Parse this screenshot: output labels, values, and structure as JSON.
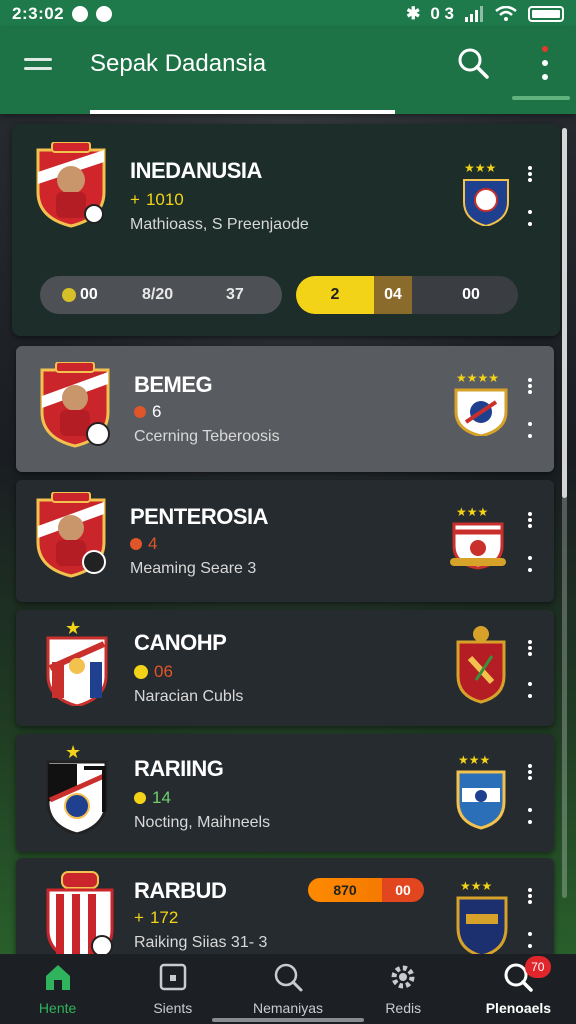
{
  "status_bar": {
    "time": "2:3:02",
    "signal_text": "0 3"
  },
  "app_bar": {
    "title": "Sepak Dadansia"
  },
  "featured": {
    "name": "INEDANUSIA",
    "stat": "1010",
    "stat_prefix": "+",
    "sub": "Mathioass, S Preenjaode",
    "score_left": [
      "00",
      "8/20",
      "37"
    ],
    "score_right": [
      "2",
      "04",
      "00"
    ]
  },
  "teams": [
    {
      "name": "BEMEG",
      "stat": "6",
      "ball_color": "#e0552a",
      "sub": "Ccerning Teberoosis"
    },
    {
      "name": "PENTEROSIA",
      "stat": "4",
      "ball_color": "#e0552a",
      "sub": "Meaming Seare 3"
    },
    {
      "name": "CANOHP",
      "stat": "06",
      "ball_color": "#f3d317",
      "sub": "Naracian Cubls"
    },
    {
      "name": "RARIING",
      "stat": "14",
      "ball_color": "#f3d317",
      "sub": "Nocting, Maihneels"
    },
    {
      "name": "RARBUD",
      "stat": "172",
      "stat_prefix": "+",
      "sub": "Raiking Siias 31- 3",
      "pill_left": "870",
      "pill_right": "00"
    }
  ],
  "bottom_nav": [
    {
      "label": "Hente",
      "icon": "home-icon"
    },
    {
      "label": "Sients",
      "icon": "stats-icon"
    },
    {
      "label": "Nemaniyas",
      "icon": "search-icon"
    },
    {
      "label": "Redis",
      "icon": "gear-icon"
    },
    {
      "label": "Plenoaels",
      "icon": "search-icon",
      "badge": "70"
    }
  ],
  "colors": {
    "accent": "#1d7346",
    "active_nav": "#2fb35c",
    "yellow": "#f3d317",
    "orange": "#ff8a00"
  }
}
